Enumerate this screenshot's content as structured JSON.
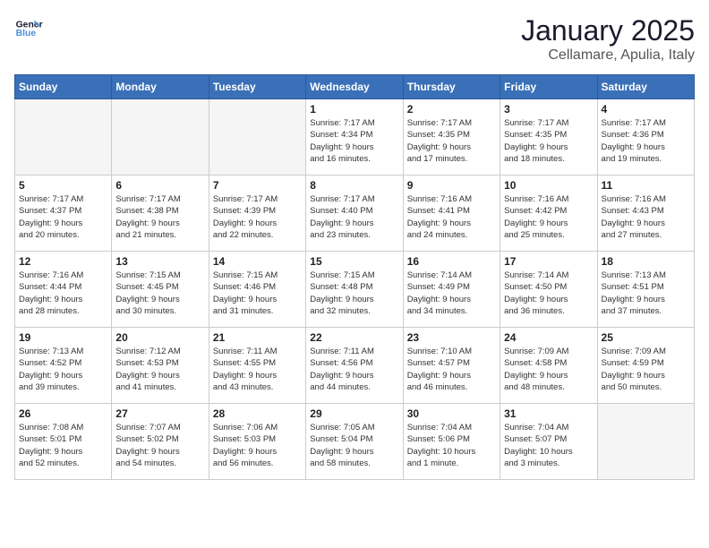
{
  "header": {
    "logo_general": "General",
    "logo_blue": "Blue",
    "month": "January 2025",
    "location": "Cellamare, Apulia, Italy"
  },
  "days_of_week": [
    "Sunday",
    "Monday",
    "Tuesday",
    "Wednesday",
    "Thursday",
    "Friday",
    "Saturday"
  ],
  "weeks": [
    [
      {
        "day": "",
        "info": ""
      },
      {
        "day": "",
        "info": ""
      },
      {
        "day": "",
        "info": ""
      },
      {
        "day": "1",
        "info": "Sunrise: 7:17 AM\nSunset: 4:34 PM\nDaylight: 9 hours\nand 16 minutes."
      },
      {
        "day": "2",
        "info": "Sunrise: 7:17 AM\nSunset: 4:35 PM\nDaylight: 9 hours\nand 17 minutes."
      },
      {
        "day": "3",
        "info": "Sunrise: 7:17 AM\nSunset: 4:35 PM\nDaylight: 9 hours\nand 18 minutes."
      },
      {
        "day": "4",
        "info": "Sunrise: 7:17 AM\nSunset: 4:36 PM\nDaylight: 9 hours\nand 19 minutes."
      }
    ],
    [
      {
        "day": "5",
        "info": "Sunrise: 7:17 AM\nSunset: 4:37 PM\nDaylight: 9 hours\nand 20 minutes."
      },
      {
        "day": "6",
        "info": "Sunrise: 7:17 AM\nSunset: 4:38 PM\nDaylight: 9 hours\nand 21 minutes."
      },
      {
        "day": "7",
        "info": "Sunrise: 7:17 AM\nSunset: 4:39 PM\nDaylight: 9 hours\nand 22 minutes."
      },
      {
        "day": "8",
        "info": "Sunrise: 7:17 AM\nSunset: 4:40 PM\nDaylight: 9 hours\nand 23 minutes."
      },
      {
        "day": "9",
        "info": "Sunrise: 7:16 AM\nSunset: 4:41 PM\nDaylight: 9 hours\nand 24 minutes."
      },
      {
        "day": "10",
        "info": "Sunrise: 7:16 AM\nSunset: 4:42 PM\nDaylight: 9 hours\nand 25 minutes."
      },
      {
        "day": "11",
        "info": "Sunrise: 7:16 AM\nSunset: 4:43 PM\nDaylight: 9 hours\nand 27 minutes."
      }
    ],
    [
      {
        "day": "12",
        "info": "Sunrise: 7:16 AM\nSunset: 4:44 PM\nDaylight: 9 hours\nand 28 minutes."
      },
      {
        "day": "13",
        "info": "Sunrise: 7:15 AM\nSunset: 4:45 PM\nDaylight: 9 hours\nand 30 minutes."
      },
      {
        "day": "14",
        "info": "Sunrise: 7:15 AM\nSunset: 4:46 PM\nDaylight: 9 hours\nand 31 minutes."
      },
      {
        "day": "15",
        "info": "Sunrise: 7:15 AM\nSunset: 4:48 PM\nDaylight: 9 hours\nand 32 minutes."
      },
      {
        "day": "16",
        "info": "Sunrise: 7:14 AM\nSunset: 4:49 PM\nDaylight: 9 hours\nand 34 minutes."
      },
      {
        "day": "17",
        "info": "Sunrise: 7:14 AM\nSunset: 4:50 PM\nDaylight: 9 hours\nand 36 minutes."
      },
      {
        "day": "18",
        "info": "Sunrise: 7:13 AM\nSunset: 4:51 PM\nDaylight: 9 hours\nand 37 minutes."
      }
    ],
    [
      {
        "day": "19",
        "info": "Sunrise: 7:13 AM\nSunset: 4:52 PM\nDaylight: 9 hours\nand 39 minutes."
      },
      {
        "day": "20",
        "info": "Sunrise: 7:12 AM\nSunset: 4:53 PM\nDaylight: 9 hours\nand 41 minutes."
      },
      {
        "day": "21",
        "info": "Sunrise: 7:11 AM\nSunset: 4:55 PM\nDaylight: 9 hours\nand 43 minutes."
      },
      {
        "day": "22",
        "info": "Sunrise: 7:11 AM\nSunset: 4:56 PM\nDaylight: 9 hours\nand 44 minutes."
      },
      {
        "day": "23",
        "info": "Sunrise: 7:10 AM\nSunset: 4:57 PM\nDaylight: 9 hours\nand 46 minutes."
      },
      {
        "day": "24",
        "info": "Sunrise: 7:09 AM\nSunset: 4:58 PM\nDaylight: 9 hours\nand 48 minutes."
      },
      {
        "day": "25",
        "info": "Sunrise: 7:09 AM\nSunset: 4:59 PM\nDaylight: 9 hours\nand 50 minutes."
      }
    ],
    [
      {
        "day": "26",
        "info": "Sunrise: 7:08 AM\nSunset: 5:01 PM\nDaylight: 9 hours\nand 52 minutes."
      },
      {
        "day": "27",
        "info": "Sunrise: 7:07 AM\nSunset: 5:02 PM\nDaylight: 9 hours\nand 54 minutes."
      },
      {
        "day": "28",
        "info": "Sunrise: 7:06 AM\nSunset: 5:03 PM\nDaylight: 9 hours\nand 56 minutes."
      },
      {
        "day": "29",
        "info": "Sunrise: 7:05 AM\nSunset: 5:04 PM\nDaylight: 9 hours\nand 58 minutes."
      },
      {
        "day": "30",
        "info": "Sunrise: 7:04 AM\nSunset: 5:06 PM\nDaylight: 10 hours\nand 1 minute."
      },
      {
        "day": "31",
        "info": "Sunrise: 7:04 AM\nSunset: 5:07 PM\nDaylight: 10 hours\nand 3 minutes."
      },
      {
        "day": "",
        "info": ""
      }
    ]
  ]
}
